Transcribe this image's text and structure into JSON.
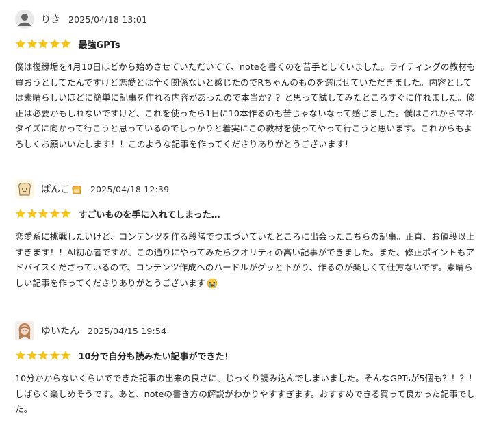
{
  "colors": {
    "star": "#f5c518",
    "text": "#222222"
  },
  "reviews": [
    {
      "user": "りき",
      "avatar": "default-user-icon",
      "date": "2025/04/18 13:01",
      "rating": 5,
      "title": "最強GPTs",
      "body": "僕は復縁垢を4月10日ほどから始めさせていただいてて、noteを書くのを苦手としていました。ライティングの教材も買おうとしてたんですけど恋愛とは全く関係ないと感じたのでRちゃんのものを選ばせていただきました。内容としては素晴らしいほどに簡単に記事を作れる内容があったので本当か？？と思って試してみたところすぐに作れました。修正は必要かもしれないですけど、これを使ったら1日に10本作るのも苦じゃないなって感じました。僕はこれからマネタイズに向かって行こうと思っているのでしっかりと着実にこの教材を使ってやって行こうと思います。これからもよろしくお願いいたします！！このような記事を作ってくださりありがとうございます！"
    },
    {
      "user": "ぱんこ",
      "name_emoji": "bread-emoji",
      "avatar": "toast-avatar-icon",
      "date": "2025/04/18 12:39",
      "rating": 5,
      "title": "すごいものを手に入れてしまった…",
      "body": "恋愛系に挑戦したいけど、コンテンツを作る段階でつまづいていたところに出会ったこちらの記事。正直、お値段以上すぎます！！AI初心者ですが、この通りにやってみたらクオリティの高い記事ができました。また、修正ポイントもアドバイスくださっているので、コンテンツ作成へのハードルがグッと下がり、作るのが楽しくて仕方ないです。素晴らしい記事を作ってくださりありがとうございます",
      "body_emoji": "crying-face-emoji"
    },
    {
      "user": "ゆいたん",
      "avatar": "girl-avatar-icon",
      "date": "2025/04/15 19:54",
      "rating": 5,
      "title": "10分で自分も読みたい記事ができた！",
      "body": "10分かからないくらいでできた記事の出来の良さに、じっくり読み込んでしまいました。そんなGPTsが5個も？！？！しばらく楽しめそうです。あと、noteの書き方の解説がわかりやすすぎます。おすすめできる買って良かった記事でした。"
    }
  ]
}
